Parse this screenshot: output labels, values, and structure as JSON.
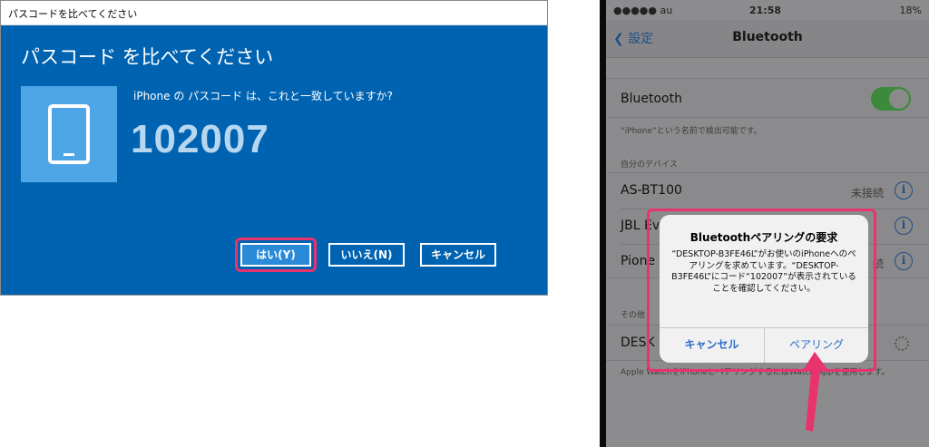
{
  "windows_dialog": {
    "titlebar": "パスコードを比べてください",
    "heading": "パスコード を比べてください",
    "question": "iPhone の パスコード は、これと一致していますか?",
    "code": "102007",
    "buttons": {
      "yes": "はい(Y)",
      "no": "いいえ(N)",
      "cancel": "キャンセル"
    },
    "colors": {
      "background": "#0063b1",
      "highlight": "#e8336d"
    }
  },
  "iphone": {
    "status_bar": {
      "carrier": "●●●●● au",
      "time": "21:58",
      "battery": "18%"
    },
    "nav": {
      "back_label": "設定",
      "title": "Bluetooth"
    },
    "bluetooth_cell": {
      "label": "Bluetooth",
      "enabled": true
    },
    "bluetooth_note": "“iPhone”という名前で検出可能です。",
    "my_devices_header": "自分のデバイス",
    "devices": [
      {
        "name": "AS-BT100",
        "status": "未接続"
      },
      {
        "name": "JBL Ev",
        "status": ""
      },
      {
        "name": "Pione",
        "status": "続"
      }
    ],
    "other_devices_header": "その他",
    "other_device": {
      "name": "DESK"
    },
    "footer_note": "Apple WatchをiPhoneとペアリングするにはWatch Appを使用します。",
    "alert": {
      "title": "Bluetoothペアリングの要求",
      "message": "“DESKTOP-B3FE46L”がお使いのiPhoneへのペアリングを求めています。“DESKTOP-B3FE46L”にコード“102007”が表示されていることを確認してください。",
      "cancel": "キャンセル",
      "pair": "ペアリング"
    }
  }
}
